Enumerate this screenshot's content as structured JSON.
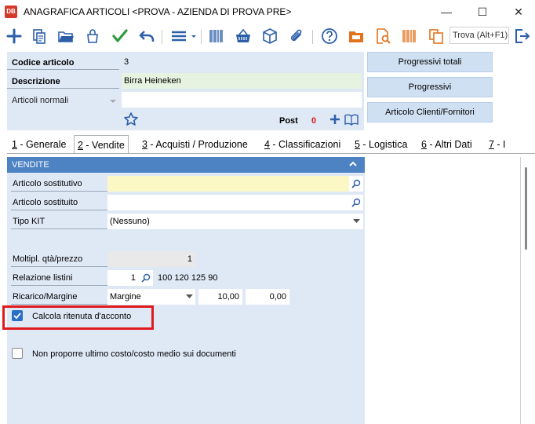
{
  "window": {
    "title": "ANAGRAFICA ARTICOLI <PROVA - AZIENDA DI PROVA PRE>",
    "app_icon_text": "DB",
    "minimize": "—",
    "maximize": "☐",
    "close": "✕"
  },
  "toolbar": {
    "search_placeholder": "Trova (Alt+F1)",
    "icons": [
      "plus-icon",
      "copy-icon",
      "folder-open-icon",
      "bag-icon",
      "checkmark-icon",
      "undo-icon",
      "menu-icon",
      "barcode-icon",
      "basket-icon",
      "box-icon",
      "paperclip-icon",
      "help-icon",
      "folder-icon",
      "search-doc-icon",
      "barcode-orange-icon",
      "copy-orange-icon",
      "exit-icon"
    ]
  },
  "header": {
    "code_label": "Codice articolo",
    "code_value": "3",
    "description_label": "Descrizione",
    "description_value": "Birra Heineken",
    "category_value": "Articoli normali",
    "post_label": "Post",
    "post_count": "0"
  },
  "side_buttons": {
    "progressivi_totali": "Progressivi totali",
    "progressivi": "Progressivi",
    "articolo_clienti": "Articolo Clienti/Fornitori"
  },
  "tabs": [
    {
      "key": "1",
      "label": " - Generale"
    },
    {
      "key": "2",
      "label": " - Vendite"
    },
    {
      "key": "3",
      "label": " - Acquisti / Produzione"
    },
    {
      "key": "4",
      "label": " - Classificazioni"
    },
    {
      "key": "5",
      "label": " - Logistica"
    },
    {
      "key": "6",
      "label": " - Altri Dati"
    },
    {
      "key": "7",
      "label": " - I"
    }
  ],
  "vendite": {
    "section_title": "VENDITE",
    "articolo_sostitutivo_label": "Articolo sostitutivo",
    "articolo_sostitutivo_value": "",
    "articolo_sostituito_label": "Articolo sostituito",
    "articolo_sostituito_value": "",
    "tipo_kit_label": "Tipo KIT",
    "tipo_kit_value": "(Nessuno)",
    "moltipl_label": "Moltipl. qtà/prezzo",
    "moltipl_value": "1",
    "relazione_label": "Relazione listini",
    "relazione_value": "1",
    "relazione_listini": "100 120 125 90",
    "ricarico_label": "Ricarico/Margine",
    "ricarico_type": "Margine",
    "ricarico_value1": "10,00",
    "ricarico_value2": "0,00",
    "ritenuta_label": "Calcola ritenuta d'acconto",
    "ritenuta_checked": true,
    "non_proporre_label": "Non proporre ultimo costo/costo medio sui documenti",
    "non_proporre_checked": false
  },
  "colors": {
    "section_header": "#4d82c3",
    "panel_bg": "#dfe9f5",
    "yellow_field": "#fcf8c6",
    "post_count": "#e0191e",
    "highlight": "#e0191e"
  }
}
